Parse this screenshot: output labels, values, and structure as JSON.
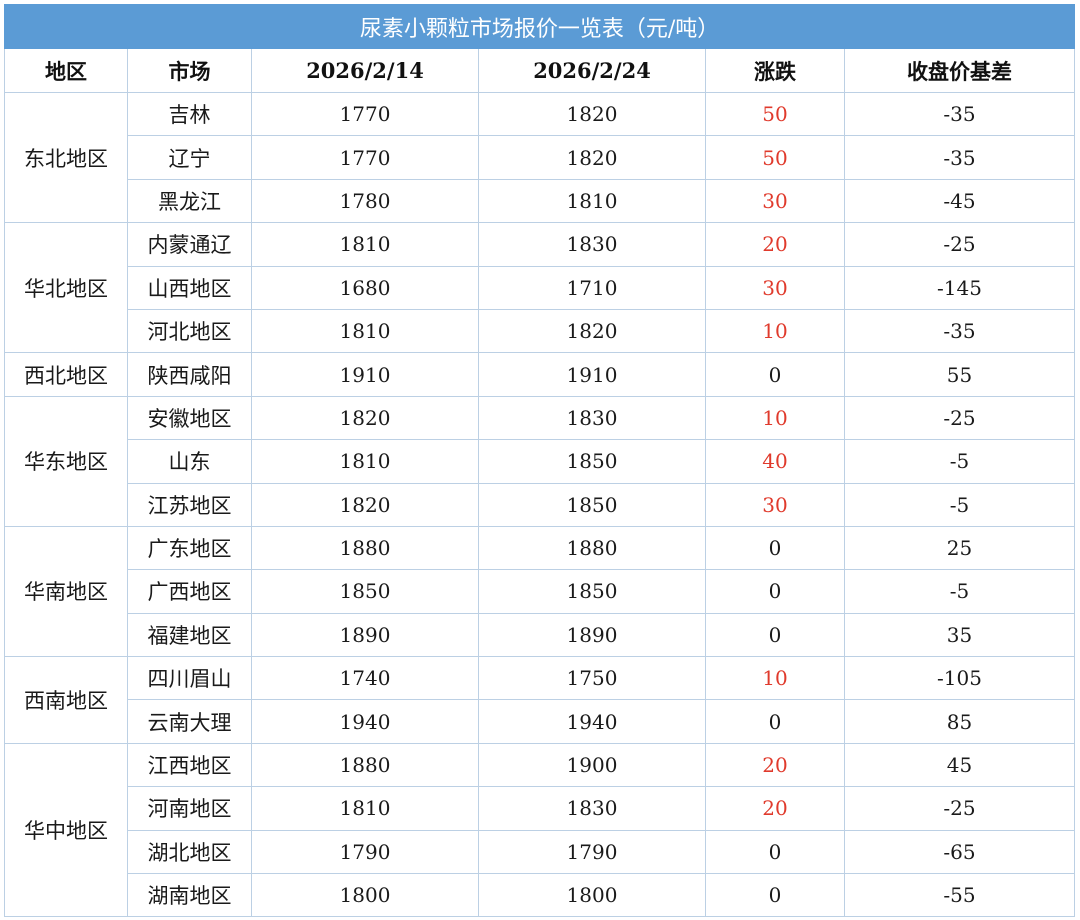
{
  "title": "尿素小颗粒市场报价一览表（元/吨）",
  "headers": [
    "地区",
    "市场",
    "2026/2/14",
    "2026/2/24",
    "涨跌",
    "收盘价基差"
  ],
  "colors": {
    "header_bg": "#5b9bd5",
    "rise": "#e03a2c",
    "border": "#bcd0e4"
  },
  "regions": [
    {
      "name": "东北地区",
      "rows": [
        {
          "market": "吉林",
          "p1": "1770",
          "p2": "1820",
          "change": "50",
          "basis": "-35"
        },
        {
          "market": "辽宁",
          "p1": "1770",
          "p2": "1820",
          "change": "50",
          "basis": "-35"
        },
        {
          "market": "黑龙江",
          "p1": "1780",
          "p2": "1810",
          "change": "30",
          "basis": "-45"
        }
      ]
    },
    {
      "name": "华北地区",
      "rows": [
        {
          "market": "内蒙通辽",
          "p1": "1810",
          "p2": "1830",
          "change": "20",
          "basis": "-25"
        },
        {
          "market": "山西地区",
          "p1": "1680",
          "p2": "1710",
          "change": "30",
          "basis": "-145"
        },
        {
          "market": "河北地区",
          "p1": "1810",
          "p2": "1820",
          "change": "10",
          "basis": "-35"
        }
      ]
    },
    {
      "name": "西北地区",
      "rows": [
        {
          "market": "陕西咸阳",
          "p1": "1910",
          "p2": "1910",
          "change": "0",
          "basis": "55"
        }
      ]
    },
    {
      "name": "华东地区",
      "rows": [
        {
          "market": "安徽地区",
          "p1": "1820",
          "p2": "1830",
          "change": "10",
          "basis": "-25"
        },
        {
          "market": "山东",
          "p1": "1810",
          "p2": "1850",
          "change": "40",
          "basis": "-5"
        },
        {
          "market": "江苏地区",
          "p1": "1820",
          "p2": "1850",
          "change": "30",
          "basis": "-5"
        }
      ]
    },
    {
      "name": "华南地区",
      "rows": [
        {
          "market": "广东地区",
          "p1": "1880",
          "p2": "1880",
          "change": "0",
          "basis": "25"
        },
        {
          "market": "广西地区",
          "p1": "1850",
          "p2": "1850",
          "change": "0",
          "basis": "-5"
        },
        {
          "market": "福建地区",
          "p1": "1890",
          "p2": "1890",
          "change": "0",
          "basis": "35"
        }
      ]
    },
    {
      "name": "西南地区",
      "rows": [
        {
          "market": "四川眉山",
          "p1": "1740",
          "p2": "1750",
          "change": "10",
          "basis": "-105"
        },
        {
          "market": "云南大理",
          "p1": "1940",
          "p2": "1940",
          "change": "0",
          "basis": "85"
        }
      ]
    },
    {
      "name": "华中地区",
      "rows": [
        {
          "market": "江西地区",
          "p1": "1880",
          "p2": "1900",
          "change": "20",
          "basis": "45"
        },
        {
          "market": "河南地区",
          "p1": "1810",
          "p2": "1830",
          "change": "20",
          "basis": "-25"
        },
        {
          "market": "湖北地区",
          "p1": "1790",
          "p2": "1790",
          "change": "0",
          "basis": "-65"
        },
        {
          "market": "湖南地区",
          "p1": "1800",
          "p2": "1800",
          "change": "0",
          "basis": "-55"
        }
      ]
    }
  ]
}
